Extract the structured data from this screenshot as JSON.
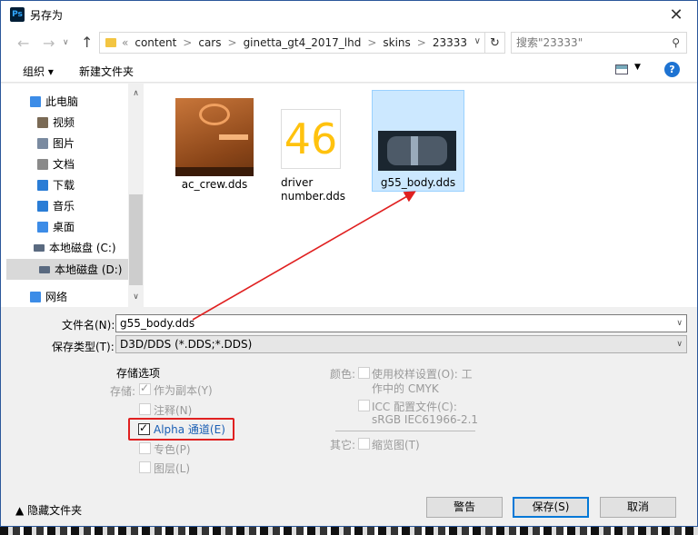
{
  "window": {
    "title": "另存为",
    "app_icon": "Ps"
  },
  "nav": {
    "breadcrumb": [
      "«",
      "content",
      ">",
      "cars",
      ">",
      "ginetta_gt4_2017_lhd",
      ">",
      "skins",
      ">",
      "23333"
    ],
    "search_placeholder": "搜索\"23333\""
  },
  "toolbar": {
    "organize": "组织 ▾",
    "new_folder": "新建文件夹"
  },
  "sidebar": {
    "items": [
      {
        "label": "此电脑",
        "icon": "pc-icon",
        "color": "#3c8ce7"
      },
      {
        "label": "视频",
        "icon": "video-icon",
        "color": "#7a6a55"
      },
      {
        "label": "图片",
        "icon": "pictures-icon",
        "color": "#7a8aa0"
      },
      {
        "label": "文档",
        "icon": "documents-icon",
        "color": "#8a8a8a"
      },
      {
        "label": "下载",
        "icon": "download-icon",
        "color": "#2a7dd6"
      },
      {
        "label": "音乐",
        "icon": "music-icon",
        "color": "#2a7dd6"
      },
      {
        "label": "桌面",
        "icon": "desktop-icon",
        "color": "#3c8ce7"
      },
      {
        "label": "本地磁盘 (C:)",
        "icon": "drive-c-icon",
        "color": "#5a6a80"
      },
      {
        "label": "本地磁盘 (D:)",
        "icon": "drive-d-icon",
        "color": "#5a6a80"
      },
      {
        "label": "网络",
        "icon": "network-icon",
        "color": "#3c8ce7"
      }
    ]
  },
  "files": [
    {
      "name": "ac_crew.dds"
    },
    {
      "name_line1": "driver",
      "name_line2": "number.dds",
      "thumb_text": "46"
    },
    {
      "name": "g55_body.dds"
    }
  ],
  "form": {
    "filename_label": "文件名(N):",
    "filename_value": "g55_body.dds",
    "filetype_label": "保存类型(T):",
    "filetype_value": "D3D/DDS (*.DDS;*.DDS)"
  },
  "options": {
    "title": "存储选项",
    "store_label": "存储:",
    "as_copy": "作为副本(Y)",
    "notes": "注释(N)",
    "alpha": "Alpha 通道(E)",
    "spot": "专色(P)",
    "layers": "图层(L)",
    "color_label": "颜色:",
    "proof_line1": "使用校样设置(O):  工",
    "proof_line2": "作中的 CMYK",
    "icc_line1": "ICC 配置文件(C):",
    "icc_line2": "sRGB IEC61966-2.1",
    "other_label": "其它:",
    "thumbnail": "缩览图(T)"
  },
  "buttons": {
    "hide_folders": "隐藏文件夹",
    "warning": "警告",
    "save": "保存(S)",
    "cancel": "取消"
  }
}
